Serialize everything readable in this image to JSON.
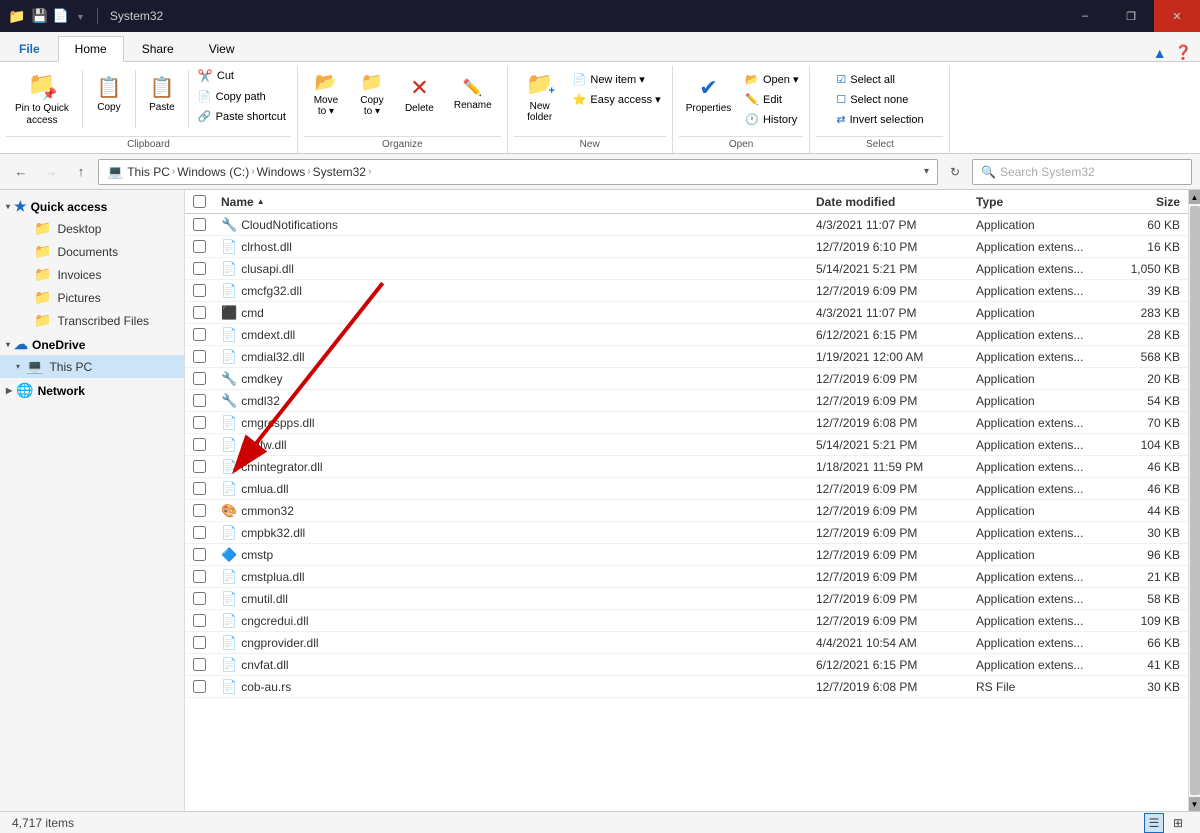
{
  "titleBar": {
    "title": "System32",
    "saveIcon": "💾",
    "minimizeLabel": "–",
    "maximizeLabel": "❐",
    "closeLabel": "✕"
  },
  "ribbonTabs": [
    {
      "label": "File",
      "active": false
    },
    {
      "label": "Home",
      "active": true
    },
    {
      "label": "Share",
      "active": false
    },
    {
      "label": "View",
      "active": false
    }
  ],
  "ribbon": {
    "clipboard": {
      "label": "Clipboard",
      "pinToQuickAccess": "Pin to Quick\naccess",
      "copy": "Copy",
      "paste": "Paste",
      "cut": "Cut",
      "copyPath": "Copy path",
      "pasteShortcut": "Paste shortcut"
    },
    "organize": {
      "label": "Organize",
      "moveTo": "Move\nto",
      "copyTo": "Copy\nto",
      "delete": "Delete",
      "rename": "Rename"
    },
    "new": {
      "label": "New",
      "newItem": "New item ▾",
      "easyAccess": "Easy access ▾",
      "newFolder": "New\nfolder"
    },
    "open": {
      "label": "Open",
      "properties": "Properties",
      "open": "Open ▾",
      "edit": "Edit",
      "history": "History"
    },
    "select": {
      "label": "Select",
      "selectAll": "Select all",
      "selectNone": "Select none",
      "invertSelection": "Invert selection"
    }
  },
  "addressBar": {
    "backDisabled": false,
    "forwardDisabled": true,
    "upDisabled": false,
    "breadcrumbs": [
      "This PC",
      "Windows (C:)",
      "Windows",
      "System32"
    ],
    "searchPlaceholder": "Search System32"
  },
  "sidebar": {
    "quickAccess": "Quick access",
    "oneDrive": "OneDrive",
    "thisPC": "This PC",
    "network": "Network",
    "items": [
      {
        "label": "Desktop",
        "type": "folder"
      },
      {
        "label": "Documents",
        "type": "folder"
      },
      {
        "label": "Invoices",
        "type": "folder"
      },
      {
        "label": "Pictures",
        "type": "folder"
      },
      {
        "label": "Transcribed Files",
        "type": "folder"
      }
    ]
  },
  "fileList": {
    "columns": [
      "Name",
      "Date modified",
      "Type",
      "Size"
    ],
    "files": [
      {
        "name": "CloudNotifications",
        "date": "4/3/2021 11:07 PM",
        "type": "Application",
        "size": "60 KB",
        "icon": "app"
      },
      {
        "name": "clrhost.dll",
        "date": "12/7/2019 6:10 PM",
        "type": "Application extens...",
        "size": "16 KB",
        "icon": "dll"
      },
      {
        "name": "clusapi.dll",
        "date": "5/14/2021 5:21 PM",
        "type": "Application extens...",
        "size": "1,050 KB",
        "icon": "dll"
      },
      {
        "name": "cmcfg32.dll",
        "date": "12/7/2019 6:09 PM",
        "type": "Application extens...",
        "size": "39 KB",
        "icon": "dll"
      },
      {
        "name": "cmd",
        "date": "4/3/2021 11:07 PM",
        "type": "Application",
        "size": "283 KB",
        "icon": "cmd"
      },
      {
        "name": "cmdext.dll",
        "date": "6/12/2021 6:15 PM",
        "type": "Application extens...",
        "size": "28 KB",
        "icon": "dll"
      },
      {
        "name": "cmdial32.dll",
        "date": "1/19/2021 12:00 AM",
        "type": "Application extens...",
        "size": "568 KB",
        "icon": "dll"
      },
      {
        "name": "cmdkey",
        "date": "12/7/2019 6:09 PM",
        "type": "Application",
        "size": "20 KB",
        "icon": "app"
      },
      {
        "name": "cmdl32",
        "date": "12/7/2019 6:09 PM",
        "type": "Application",
        "size": "54 KB",
        "icon": "app"
      },
      {
        "name": "cmgrcspps.dll",
        "date": "12/7/2019 6:08 PM",
        "type": "Application extens...",
        "size": "70 KB",
        "icon": "dll"
      },
      {
        "name": "cmifw.dll",
        "date": "5/14/2021 5:21 PM",
        "type": "Application extens...",
        "size": "104 KB",
        "icon": "dll"
      },
      {
        "name": "cmintegrator.dll",
        "date": "1/18/2021 11:59 PM",
        "type": "Application extens...",
        "size": "46 KB",
        "icon": "dll"
      },
      {
        "name": "cmlua.dll",
        "date": "12/7/2019 6:09 PM",
        "type": "Application extens...",
        "size": "46 KB",
        "icon": "dll"
      },
      {
        "name": "cmmon32",
        "date": "12/7/2019 6:09 PM",
        "type": "Application",
        "size": "44 KB",
        "icon": "cmmon"
      },
      {
        "name": "cmpbk32.dll",
        "date": "12/7/2019 6:09 PM",
        "type": "Application extens...",
        "size": "30 KB",
        "icon": "dll"
      },
      {
        "name": "cmstp",
        "date": "12/7/2019 6:09 PM",
        "type": "Application",
        "size": "96 KB",
        "icon": "cmstp"
      },
      {
        "name": "cmstplua.dll",
        "date": "12/7/2019 6:09 PM",
        "type": "Application extens...",
        "size": "21 KB",
        "icon": "dll"
      },
      {
        "name": "cmutil.dll",
        "date": "12/7/2019 6:09 PM",
        "type": "Application extens...",
        "size": "58 KB",
        "icon": "dll"
      },
      {
        "name": "cngcredui.dll",
        "date": "12/7/2019 6:09 PM",
        "type": "Application extens...",
        "size": "109 KB",
        "icon": "dll"
      },
      {
        "name": "cngprovider.dll",
        "date": "4/4/2021 10:54 AM",
        "type": "Application extens...",
        "size": "66 KB",
        "icon": "dll"
      },
      {
        "name": "cnvfat.dll",
        "date": "6/12/2021 6:15 PM",
        "type": "Application extens...",
        "size": "41 KB",
        "icon": "dll"
      },
      {
        "name": "cob-au.rs",
        "date": "12/7/2019 6:08 PM",
        "type": "RS File",
        "size": "30 KB",
        "icon": "rs"
      }
    ]
  },
  "statusBar": {
    "itemCount": "4,717 items"
  }
}
